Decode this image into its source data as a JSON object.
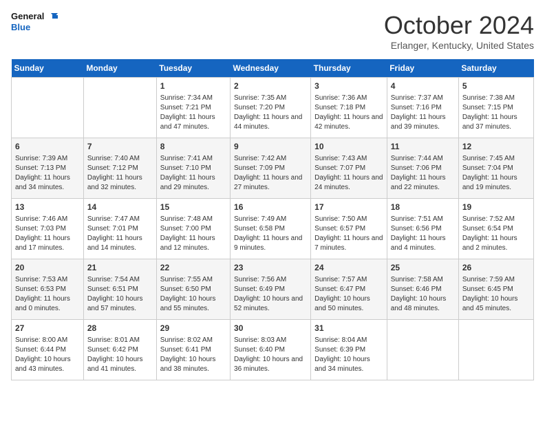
{
  "header": {
    "logo_line1": "General",
    "logo_line2": "Blue",
    "month": "October 2024",
    "location": "Erlanger, Kentucky, United States"
  },
  "days_of_week": [
    "Sunday",
    "Monday",
    "Tuesday",
    "Wednesday",
    "Thursday",
    "Friday",
    "Saturday"
  ],
  "weeks": [
    [
      {
        "day": "",
        "content": ""
      },
      {
        "day": "",
        "content": ""
      },
      {
        "day": "1",
        "content": "Sunrise: 7:34 AM\nSunset: 7:21 PM\nDaylight: 11 hours and 47 minutes."
      },
      {
        "day": "2",
        "content": "Sunrise: 7:35 AM\nSunset: 7:20 PM\nDaylight: 11 hours and 44 minutes."
      },
      {
        "day": "3",
        "content": "Sunrise: 7:36 AM\nSunset: 7:18 PM\nDaylight: 11 hours and 42 minutes."
      },
      {
        "day": "4",
        "content": "Sunrise: 7:37 AM\nSunset: 7:16 PM\nDaylight: 11 hours and 39 minutes."
      },
      {
        "day": "5",
        "content": "Sunrise: 7:38 AM\nSunset: 7:15 PM\nDaylight: 11 hours and 37 minutes."
      }
    ],
    [
      {
        "day": "6",
        "content": "Sunrise: 7:39 AM\nSunset: 7:13 PM\nDaylight: 11 hours and 34 minutes."
      },
      {
        "day": "7",
        "content": "Sunrise: 7:40 AM\nSunset: 7:12 PM\nDaylight: 11 hours and 32 minutes."
      },
      {
        "day": "8",
        "content": "Sunrise: 7:41 AM\nSunset: 7:10 PM\nDaylight: 11 hours and 29 minutes."
      },
      {
        "day": "9",
        "content": "Sunrise: 7:42 AM\nSunset: 7:09 PM\nDaylight: 11 hours and 27 minutes."
      },
      {
        "day": "10",
        "content": "Sunrise: 7:43 AM\nSunset: 7:07 PM\nDaylight: 11 hours and 24 minutes."
      },
      {
        "day": "11",
        "content": "Sunrise: 7:44 AM\nSunset: 7:06 PM\nDaylight: 11 hours and 22 minutes."
      },
      {
        "day": "12",
        "content": "Sunrise: 7:45 AM\nSunset: 7:04 PM\nDaylight: 11 hours and 19 minutes."
      }
    ],
    [
      {
        "day": "13",
        "content": "Sunrise: 7:46 AM\nSunset: 7:03 PM\nDaylight: 11 hours and 17 minutes."
      },
      {
        "day": "14",
        "content": "Sunrise: 7:47 AM\nSunset: 7:01 PM\nDaylight: 11 hours and 14 minutes."
      },
      {
        "day": "15",
        "content": "Sunrise: 7:48 AM\nSunset: 7:00 PM\nDaylight: 11 hours and 12 minutes."
      },
      {
        "day": "16",
        "content": "Sunrise: 7:49 AM\nSunset: 6:58 PM\nDaylight: 11 hours and 9 minutes."
      },
      {
        "day": "17",
        "content": "Sunrise: 7:50 AM\nSunset: 6:57 PM\nDaylight: 11 hours and 7 minutes."
      },
      {
        "day": "18",
        "content": "Sunrise: 7:51 AM\nSunset: 6:56 PM\nDaylight: 11 hours and 4 minutes."
      },
      {
        "day": "19",
        "content": "Sunrise: 7:52 AM\nSunset: 6:54 PM\nDaylight: 11 hours and 2 minutes."
      }
    ],
    [
      {
        "day": "20",
        "content": "Sunrise: 7:53 AM\nSunset: 6:53 PM\nDaylight: 11 hours and 0 minutes."
      },
      {
        "day": "21",
        "content": "Sunrise: 7:54 AM\nSunset: 6:51 PM\nDaylight: 10 hours and 57 minutes."
      },
      {
        "day": "22",
        "content": "Sunrise: 7:55 AM\nSunset: 6:50 PM\nDaylight: 10 hours and 55 minutes."
      },
      {
        "day": "23",
        "content": "Sunrise: 7:56 AM\nSunset: 6:49 PM\nDaylight: 10 hours and 52 minutes."
      },
      {
        "day": "24",
        "content": "Sunrise: 7:57 AM\nSunset: 6:47 PM\nDaylight: 10 hours and 50 minutes."
      },
      {
        "day": "25",
        "content": "Sunrise: 7:58 AM\nSunset: 6:46 PM\nDaylight: 10 hours and 48 minutes."
      },
      {
        "day": "26",
        "content": "Sunrise: 7:59 AM\nSunset: 6:45 PM\nDaylight: 10 hours and 45 minutes."
      }
    ],
    [
      {
        "day": "27",
        "content": "Sunrise: 8:00 AM\nSunset: 6:44 PM\nDaylight: 10 hours and 43 minutes."
      },
      {
        "day": "28",
        "content": "Sunrise: 8:01 AM\nSunset: 6:42 PM\nDaylight: 10 hours and 41 minutes."
      },
      {
        "day": "29",
        "content": "Sunrise: 8:02 AM\nSunset: 6:41 PM\nDaylight: 10 hours and 38 minutes."
      },
      {
        "day": "30",
        "content": "Sunrise: 8:03 AM\nSunset: 6:40 PM\nDaylight: 10 hours and 36 minutes."
      },
      {
        "day": "31",
        "content": "Sunrise: 8:04 AM\nSunset: 6:39 PM\nDaylight: 10 hours and 34 minutes."
      },
      {
        "day": "",
        "content": ""
      },
      {
        "day": "",
        "content": ""
      }
    ]
  ]
}
